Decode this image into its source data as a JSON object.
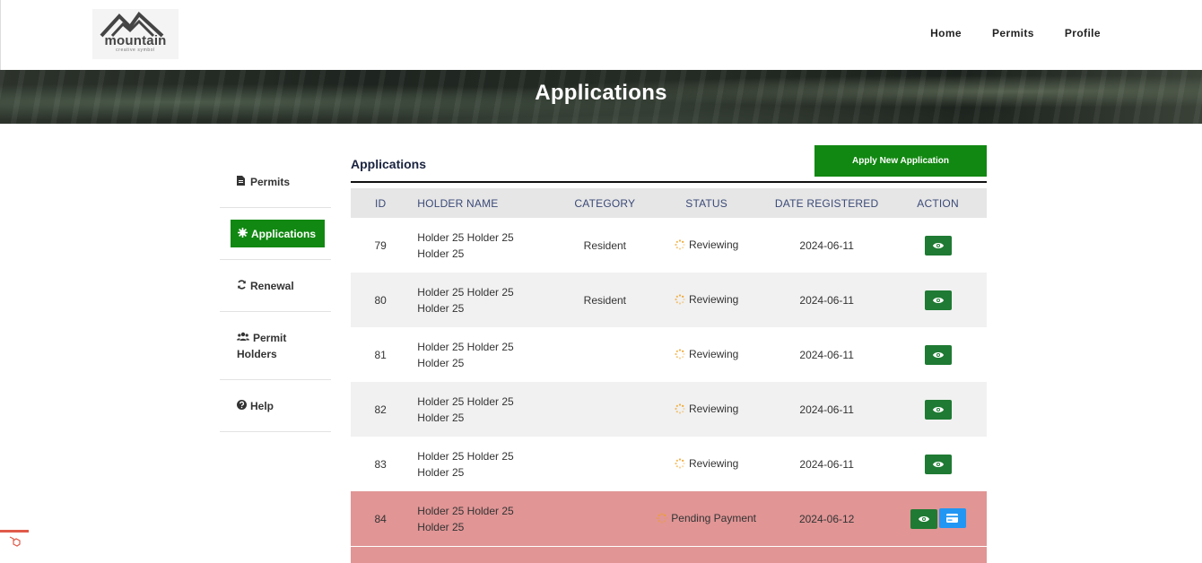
{
  "header": {
    "logo_text": "mountain",
    "logo_subtext": "creative symbol",
    "nav": [
      {
        "label": "Home"
      },
      {
        "label": "Permits"
      },
      {
        "label": "Profile"
      }
    ]
  },
  "banner": {
    "title": "Applications"
  },
  "sidebar": {
    "items": [
      {
        "label": "Permits",
        "icon": "file-icon"
      },
      {
        "label": "Applications",
        "icon": "gear-icon",
        "active": true
      },
      {
        "label": "Renewal",
        "icon": "refresh-icon"
      },
      {
        "label": "Permit",
        "label2": "Holders",
        "icon": "users-icon"
      },
      {
        "label": "Help",
        "icon": "question-icon"
      }
    ]
  },
  "main": {
    "title": "Applications",
    "apply_button": "Apply New Application",
    "columns": [
      "ID",
      "HOLDER NAME",
      "CATEGORY",
      "STATUS",
      "DATE REGISTERED",
      "ACTION"
    ],
    "rows": [
      {
        "id": "79",
        "name1": "Holder 25 Holder 25",
        "name2": "Holder 25",
        "category": "Resident",
        "status": "Reviewing",
        "date": "2024-06-11"
      },
      {
        "id": "80",
        "name1": "Holder 25 Holder 25",
        "name2": "Holder 25",
        "category": "Resident",
        "status": "Reviewing",
        "date": "2024-06-11"
      },
      {
        "id": "81",
        "name1": "Holder 25 Holder 25",
        "name2": "Holder 25",
        "category": "",
        "status": "Reviewing",
        "date": "2024-06-11"
      },
      {
        "id": "82",
        "name1": "Holder 25 Holder 25",
        "name2": "Holder 25",
        "category": "",
        "status": "Reviewing",
        "date": "2024-06-11"
      },
      {
        "id": "83",
        "name1": "Holder 25 Holder 25",
        "name2": "Holder 25",
        "category": "",
        "status": "Reviewing",
        "date": "2024-06-11"
      },
      {
        "id": "84",
        "name1": "Holder 25 Holder 25",
        "name2": "Holder 25",
        "category": "",
        "status": "Pending Payment",
        "date": "2024-06-12"
      }
    ]
  },
  "colors": {
    "accent_green": "#118811",
    "view_green": "#1f7a33",
    "pay_blue": "#2196f3",
    "pending_row": "#e19595",
    "header_text": "#3b4a78"
  }
}
